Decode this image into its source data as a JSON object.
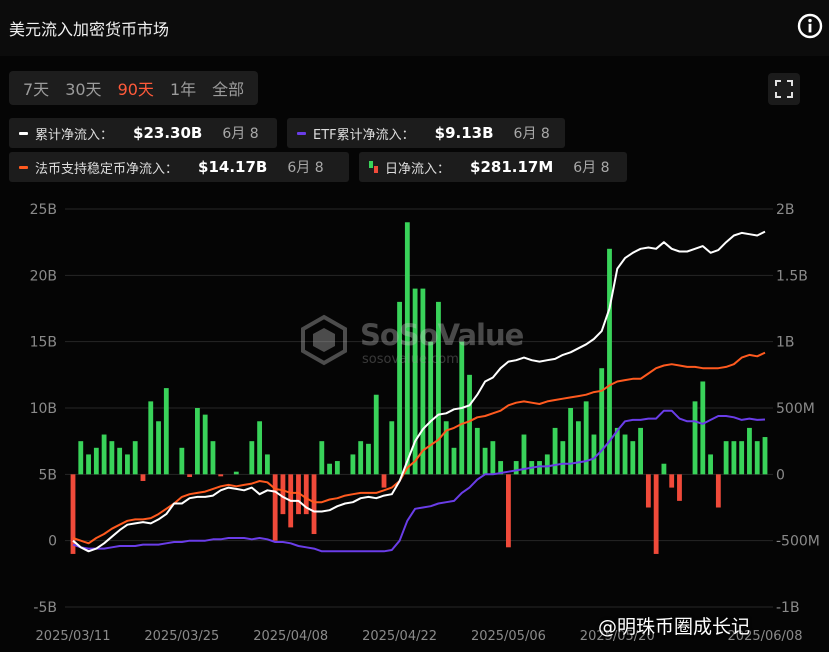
{
  "header": {
    "title": "美元流入加密货币市场",
    "info_icon": "info-circle-icon"
  },
  "tabs": [
    {
      "label": "7天",
      "active": false
    },
    {
      "label": "30天",
      "active": false
    },
    {
      "label": "90天",
      "active": true
    },
    {
      "label": "1年",
      "active": false
    },
    {
      "label": "全部",
      "active": false
    }
  ],
  "fullscreen_icon": "fullscreen-icon",
  "legend": [
    {
      "label": "累计净流入：",
      "value": "$23.30B",
      "date": "6月 8",
      "color": "#ffffff",
      "marker": "line"
    },
    {
      "label": "ETF累计净流入：",
      "value": "$9.13B",
      "date": "6月 8",
      "color": "#6a3de8",
      "marker": "line"
    },
    {
      "label": "法币支持稳定币净流入：",
      "value": "$14.17B",
      "date": "6月 8",
      "color": "#ff5a1f",
      "marker": "line"
    },
    {
      "label": "日净流入：",
      "value": "$281.17M",
      "date": "6月 8",
      "color": "#2ecc71",
      "marker": "bar"
    }
  ],
  "watermark": {
    "brand": "SoSoValue",
    "domain": "sosovalue.com"
  },
  "source_mark": "@明珠币圈成长记",
  "chart_data": {
    "type": "bar",
    "title": "",
    "xlabel": "",
    "ylabel": "",
    "colors": {
      "positive_bar": "#39d35a",
      "negative_bar": "#f04a3a",
      "cumulative": "#ffffff",
      "etf": "#6a3de8",
      "stablecoin": "#ff5a1f",
      "grid": "#262626",
      "axis_text": "#8a8a8a"
    },
    "y_left": {
      "min": -5,
      "max": 25,
      "ticks": [
        "-5B",
        "0",
        "5B",
        "10B",
        "15B",
        "20B",
        "25B"
      ],
      "tick_values": [
        -5,
        0,
        5,
        10,
        15,
        20,
        25
      ],
      "unit": "B"
    },
    "y_right": {
      "min": -1000,
      "max": 2000,
      "ticks": [
        "-1B",
        "-500M",
        "0",
        "500M",
        "1B",
        "1.5B",
        "2B"
      ],
      "tick_values": [
        -1000,
        -500,
        0,
        500,
        1000,
        1500,
        2000
      ],
      "unit": "M"
    },
    "x_ticks": [
      {
        "label": "2025/03/11",
        "index": 0
      },
      {
        "label": "2025/03/25",
        "index": 14
      },
      {
        "label": "2025/04/08",
        "index": 28
      },
      {
        "label": "2025/04/22",
        "index": 42
      },
      {
        "label": "2025/05/06",
        "index": 56
      },
      {
        "label": "2025/05/20",
        "index": 70
      },
      {
        "label": "2025/06/08",
        "index": 89
      }
    ],
    "start_date": "2025/03/11",
    "end_date": "2025/06/08",
    "daily_net_inflow_M": [
      -600,
      250,
      150,
      200,
      300,
      250,
      200,
      150,
      250,
      -50,
      550,
      400,
      650,
      0,
      200,
      -20,
      500,
      450,
      250,
      -15,
      0,
      20,
      0,
      250,
      400,
      150,
      -500,
      -300,
      -400,
      -300,
      -300,
      -450,
      250,
      80,
      100,
      0,
      150,
      250,
      230,
      600,
      -100,
      400,
      1300,
      1900,
      1400,
      1400,
      1000,
      1300,
      400,
      200,
      1000,
      750,
      350,
      200,
      250,
      100,
      -550,
      100,
      300,
      100,
      100,
      150,
      350,
      250,
      500,
      400,
      550,
      300,
      800,
      1700,
      350,
      300,
      250,
      350,
      -250,
      -600,
      80,
      -100,
      -200,
      0,
      550,
      700,
      150,
      -250,
      250,
      250,
      250,
      350,
      250,
      281
    ],
    "series": [
      {
        "name": "累计净流入",
        "axis": "left",
        "values": [
          0,
          -0.5,
          -0.8,
          -0.6,
          -0.2,
          0.3,
          0.8,
          1.2,
          1.3,
          1.4,
          1.3,
          1.6,
          2.0,
          2.8,
          2.8,
          3.2,
          3.3,
          3.3,
          3.4,
          3.8,
          4.0,
          3.9,
          3.8,
          4.0,
          3.5,
          3.8,
          3.7,
          3.3,
          3.0,
          3.0,
          2.5,
          2.2,
          2.2,
          2.3,
          2.6,
          2.8,
          2.9,
          3.2,
          3.3,
          3.2,
          3.4,
          3.5,
          4.5,
          6.0,
          7.5,
          8.4,
          9.0,
          9.5,
          9.6,
          9.9,
          10.0,
          10.2,
          11.0,
          12.0,
          12.3,
          13.0,
          13.5,
          13.6,
          13.8,
          13.6,
          13.5,
          13.6,
          13.7,
          14.0,
          14.2,
          14.5,
          14.8,
          15.2,
          15.8,
          17.5,
          20.5,
          21.3,
          21.7,
          22.0,
          22.1,
          22.0,
          22.5,
          22.0,
          21.8,
          21.8,
          22.0,
          22.2,
          21.7,
          21.9,
          22.5,
          23.0,
          23.2,
          23.1,
          23.0,
          23.3
        ]
      },
      {
        "name": "ETF累计净流入",
        "axis": "left",
        "values": [
          -0.3,
          -0.5,
          -0.6,
          -0.6,
          -0.6,
          -0.5,
          -0.4,
          -0.4,
          -0.4,
          -0.3,
          -0.3,
          -0.3,
          -0.2,
          -0.1,
          -0.1,
          0.0,
          0.0,
          0.0,
          0.1,
          0.1,
          0.2,
          0.2,
          0.2,
          0.1,
          0.2,
          0.1,
          -0.1,
          -0.1,
          -0.2,
          -0.4,
          -0.5,
          -0.6,
          -0.8,
          -0.8,
          -0.8,
          -0.8,
          -0.8,
          -0.8,
          -0.8,
          -0.8,
          -0.8,
          -0.7,
          0.0,
          1.5,
          2.4,
          2.5,
          2.6,
          2.8,
          2.9,
          3.0,
          3.6,
          4.0,
          4.6,
          5.0,
          5.0,
          5.1,
          5.2,
          5.3,
          5.4,
          5.5,
          5.6,
          5.6,
          5.7,
          5.8,
          5.8,
          5.9,
          6.0,
          6.2,
          6.8,
          7.5,
          8.3,
          9.0,
          9.1,
          9.1,
          9.2,
          9.2,
          9.8,
          9.8,
          9.2,
          9.0,
          9.0,
          8.8,
          9.1,
          9.4,
          9.4,
          9.3,
          9.1,
          9.2,
          9.1,
          9.13
        ]
      },
      {
        "name": "法币支持稳定币净流入",
        "axis": "left",
        "values": [
          0.2,
          0.0,
          -0.2,
          0.2,
          0.5,
          0.9,
          1.2,
          1.5,
          1.6,
          1.6,
          1.7,
          2.0,
          2.4,
          2.8,
          3.3,
          3.5,
          3.6,
          3.7,
          3.9,
          4.1,
          4.2,
          4.1,
          4.2,
          4.3,
          4.5,
          4.4,
          3.9,
          3.8,
          3.6,
          3.6,
          3.2,
          2.9,
          2.9,
          3.1,
          3.2,
          3.4,
          3.5,
          3.6,
          3.6,
          3.6,
          3.8,
          4.0,
          4.5,
          5.5,
          6.0,
          6.8,
          7.2,
          7.6,
          8.3,
          8.5,
          8.8,
          9.0,
          9.3,
          9.4,
          9.6,
          9.8,
          10.2,
          10.4,
          10.5,
          10.4,
          10.3,
          10.5,
          10.6,
          10.7,
          10.8,
          10.9,
          11.0,
          11.2,
          11.3,
          11.7,
          12.0,
          12.1,
          12.2,
          12.2,
          12.6,
          13.0,
          13.2,
          13.3,
          13.2,
          13.1,
          13.1,
          13.0,
          13.0,
          13.0,
          13.1,
          13.3,
          13.8,
          14.0,
          13.9,
          14.17
        ]
      }
    ],
    "grid": true,
    "legend_position": "top-left"
  }
}
